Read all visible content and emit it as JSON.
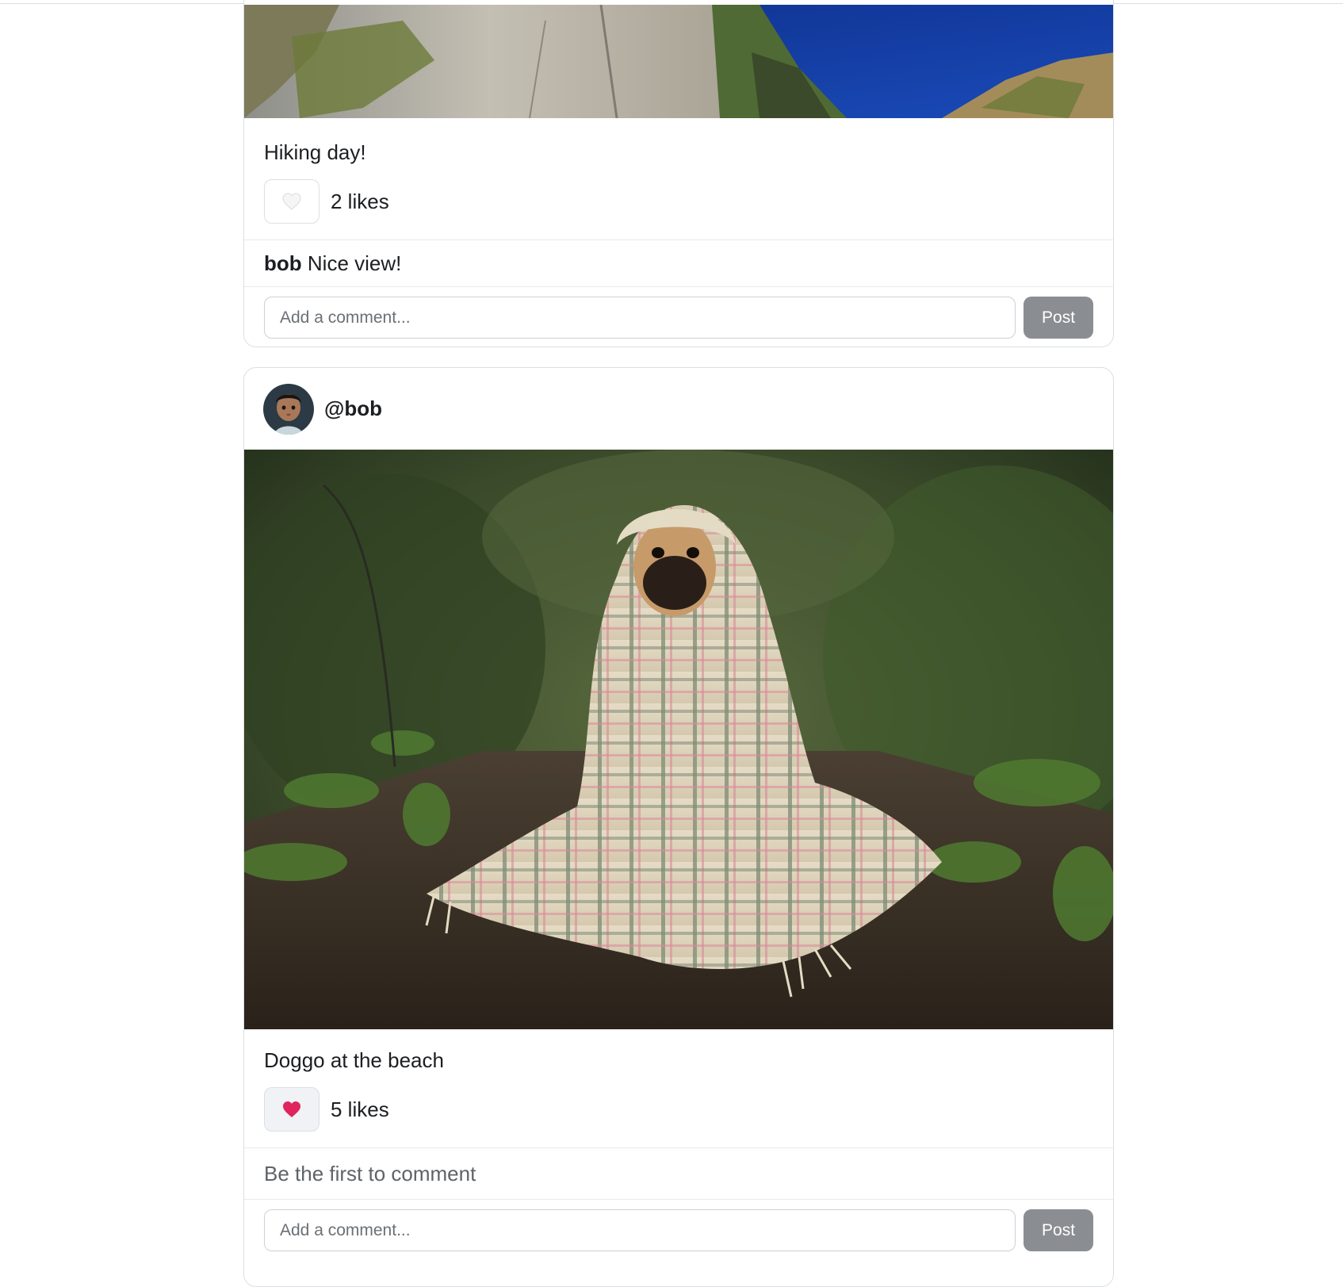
{
  "posts": [
    {
      "caption": "Hiking day!",
      "liked": false,
      "like_icon": "white-heart-icon",
      "likes_label": "2 likes",
      "comments": [
        {
          "author": "bob",
          "text": "Nice view!"
        }
      ],
      "comment_placeholder": "Add a comment...",
      "post_label": "Post",
      "image_description": "cliff-over-fjord-photo"
    },
    {
      "username": "@bob",
      "avatar": "child-avatar",
      "caption": "Doggo at the beach",
      "liked": true,
      "like_icon": "red-heart-icon",
      "likes_label": "5 likes",
      "empty_comments_text": "Be the first to comment",
      "comment_placeholder": "Add a comment...",
      "post_label": "Post",
      "image_description": "pug-in-blanket-photo"
    }
  ],
  "colors": {
    "heart_liked": "#e0245e",
    "post_button": "#8a8d91",
    "card_border": "#dcdfe3"
  }
}
